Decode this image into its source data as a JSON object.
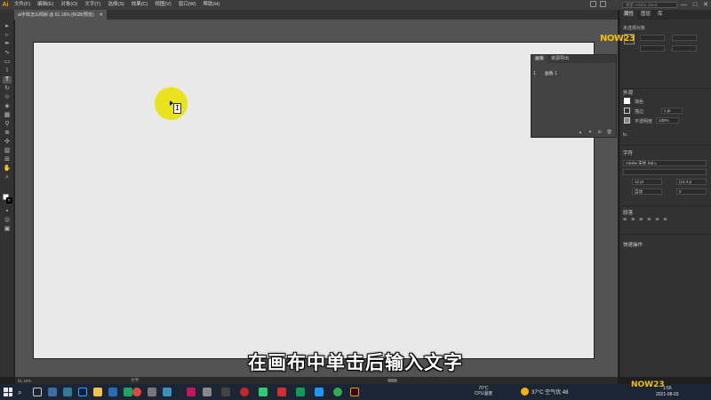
{
  "menubar": {
    "app_icon": "Ai",
    "menus": [
      "文件(F)",
      "编辑(E)",
      "对象(O)",
      "文字(T)",
      "选择(S)",
      "效果(C)",
      "视图(V)",
      "窗口(W)",
      "帮助(H)"
    ],
    "search_placeholder": "搜索 Adobe Stock",
    "controls": [
      "—",
      "□",
      "✕"
    ]
  },
  "document_tab": {
    "title": "ai字体怎么倾斜 @ 61.16% (RGB/预览)",
    "close": "✕"
  },
  "artboards_panel": {
    "tabs": [
      "画板",
      "资源导出"
    ],
    "row": {
      "index": "1",
      "name": "画板 1"
    }
  },
  "properties_panel": {
    "tabs": [
      "属性",
      "图层",
      "库"
    ],
    "no_selection": "未选择对象",
    "appearance_title": "外观",
    "fill_label": "填色",
    "stroke_label": "描边",
    "stroke_value": "1 pt",
    "opacity_label": "不透明度",
    "opacity_value": "100%",
    "fx_label": "fx.",
    "character_title": "字符",
    "font_value": "Adobe 宋体 Std L",
    "font_size": "12 pt",
    "leading": "(14.4 p",
    "auto_label": "自动",
    "kerning": "0",
    "paragraph_title": "段落",
    "quick_actions_title": "快速操作"
  },
  "status_bar": {
    "zoom": "61.16%",
    "tool": "文字"
  },
  "subtitle": "在画布中单击后输入文字",
  "watermark": "NOW23",
  "taskbar": {
    "cpu_temp": "70°C",
    "cpu_label": "CPU温度",
    "weather": "37°C  空气优 48",
    "time": "1:56",
    "date": "2021-08-03"
  },
  "colors": {
    "highlight": "#e8e31a",
    "artboard": "#e9e9e9",
    "workspace": "#535353"
  }
}
